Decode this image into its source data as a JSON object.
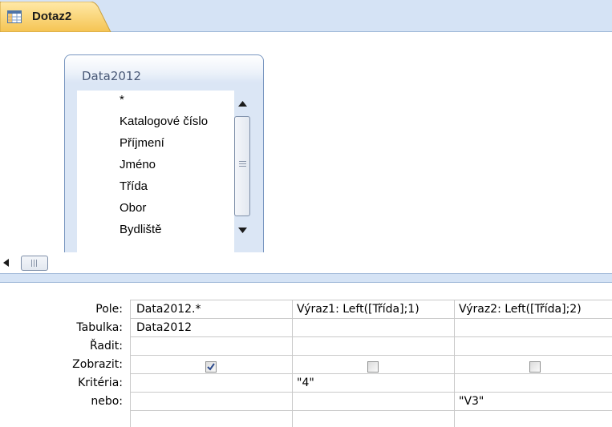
{
  "tab": {
    "title": "Dotaz2",
    "icon": "query-grid-icon"
  },
  "table_box": {
    "title": "Data2012",
    "fields": [
      "*",
      "Katalogové číslo",
      "Příjmení",
      "Jméno",
      "Třída",
      "Obor",
      "Bydliště"
    ]
  },
  "grid": {
    "row_labels": [
      "Pole:",
      "Tabulka:",
      "Řadit:",
      "Zobrazit:",
      "Kritéria:",
      "nebo:"
    ],
    "columns": [
      {
        "pole": "Data2012.*",
        "tabulka": "Data2012",
        "zobrazit": true,
        "kriteria": "",
        "nebo": ""
      },
      {
        "pole": "Výraz1: Left([Třída];1)",
        "tabulka": "",
        "zobrazit": false,
        "kriteria": "\"4\"",
        "nebo": ""
      },
      {
        "pole": "Výraz2: Left([Třída];2)",
        "tabulka": "",
        "zobrazit": false,
        "kriteria": "",
        "nebo": "\"V3\""
      }
    ]
  },
  "colors": {
    "chrome": "#d5e3f5",
    "border": "#7896c0",
    "tab_top": "#ffe9a8",
    "tab_bottom": "#f5c452"
  }
}
